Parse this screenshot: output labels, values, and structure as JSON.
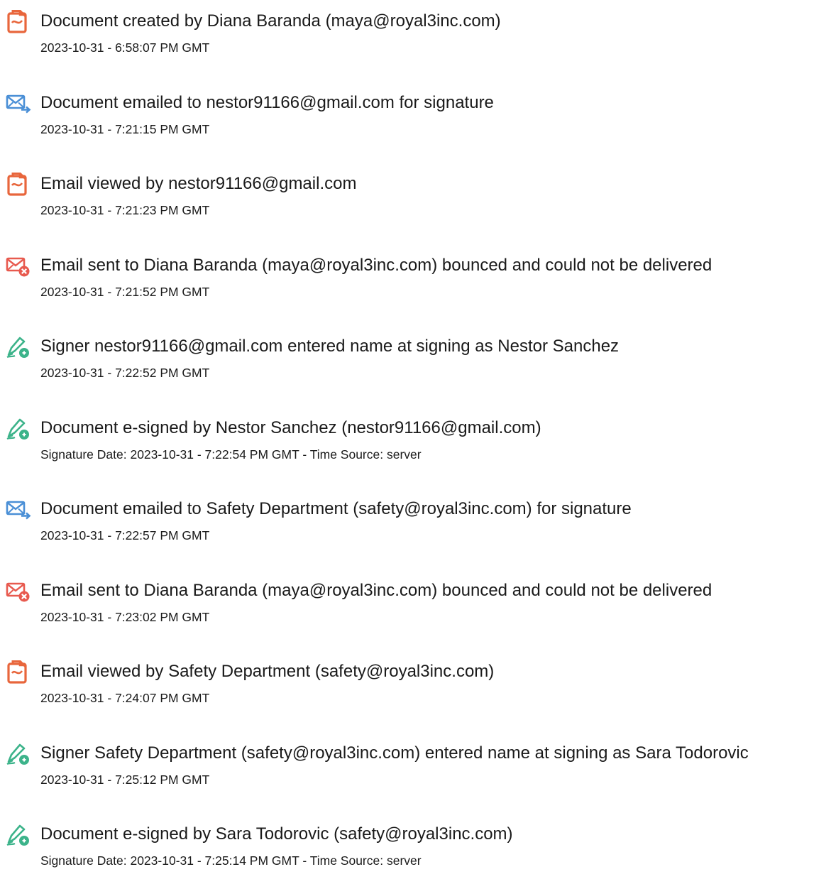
{
  "colors": {
    "created_icon": "#e8663c",
    "email_icon": "#4a8fd6",
    "bounce_icon": "#e85a4f",
    "sign_icon": "#3cb38a",
    "text": "#1a1a1a"
  },
  "events": [
    {
      "icon": "document-created-icon",
      "title": "Document created by Diana Baranda (maya@royal3inc.com)",
      "time": "2023-10-31 - 6:58:07 PM GMT"
    },
    {
      "icon": "email-sent-icon",
      "title": "Document emailed to nestor91166@gmail.com for signature",
      "time": "2023-10-31 - 7:21:15 PM GMT"
    },
    {
      "icon": "document-viewed-icon",
      "title": "Email viewed by nestor91166@gmail.com",
      "time": "2023-10-31 - 7:21:23 PM GMT"
    },
    {
      "icon": "email-bounced-icon",
      "title": "Email sent to Diana Baranda (maya@royal3inc.com) bounced and could not be delivered",
      "time": "2023-10-31 - 7:21:52 PM GMT"
    },
    {
      "icon": "e-sign-pen-icon",
      "title": "Signer nestor91166@gmail.com entered name at signing as Nestor Sanchez",
      "time": "2023-10-31 - 7:22:52 PM GMT"
    },
    {
      "icon": "e-sign-pen-icon",
      "title": "Document e-signed by Nestor Sanchez (nestor91166@gmail.com)",
      "time": "Signature Date: 2023-10-31 - 7:22:54 PM GMT - Time Source: server"
    },
    {
      "icon": "email-sent-icon",
      "title": "Document emailed to Safety Department (safety@royal3inc.com) for signature",
      "time": "2023-10-31 - 7:22:57 PM GMT"
    },
    {
      "icon": "email-bounced-icon",
      "title": "Email sent to Diana Baranda (maya@royal3inc.com) bounced and could not be delivered",
      "time": "2023-10-31 - 7:23:02 PM GMT"
    },
    {
      "icon": "document-viewed-icon",
      "title": "Email viewed by Safety Department (safety@royal3inc.com)",
      "time": "2023-10-31 - 7:24:07 PM GMT"
    },
    {
      "icon": "e-sign-pen-icon",
      "title": "Signer Safety Department (safety@royal3inc.com) entered name at signing as Sara Todorovic",
      "time": "2023-10-31 - 7:25:12 PM GMT"
    },
    {
      "icon": "e-sign-pen-icon",
      "title": "Document e-signed by Sara Todorovic (safety@royal3inc.com)",
      "time": "Signature Date: 2023-10-31 - 7:25:14 PM GMT - Time Source: server"
    }
  ]
}
